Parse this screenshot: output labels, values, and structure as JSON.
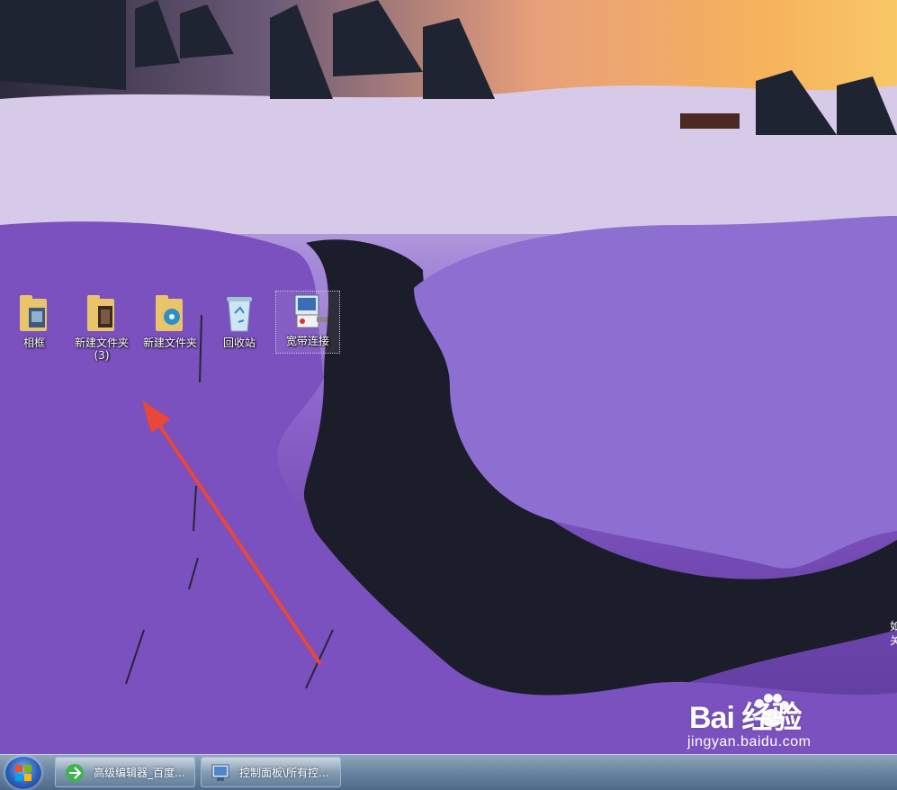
{
  "desktop": {
    "icons": [
      {
        "label": "相框",
        "icon": "folder-photos-icon"
      },
      {
        "label": "新建文件夹",
        "label2": "(3)",
        "icon": "folder-movies-icon"
      },
      {
        "label": "新建文件夹",
        "icon": "folder-media-icon"
      },
      {
        "label": "回收站",
        "icon": "recycle-bin-icon"
      },
      {
        "label": "宽带连接",
        "icon": "broadband-connection-icon"
      }
    ],
    "right_edge_text": [
      "如",
      "关"
    ]
  },
  "taskbar": {
    "start_icon": "windows-start-icon",
    "tasks": [
      {
        "label": "高级编辑器_百度...",
        "icon": "browser-icon"
      },
      {
        "label": "控制面板\\所有控...",
        "icon": "control-panel-icon"
      }
    ]
  },
  "watermark": {
    "logo": "Bai 经验",
    "url": "jingyan.baidu.com"
  },
  "colors": {
    "arrow": "#e8473a",
    "taskbar": "#6a86a3"
  }
}
